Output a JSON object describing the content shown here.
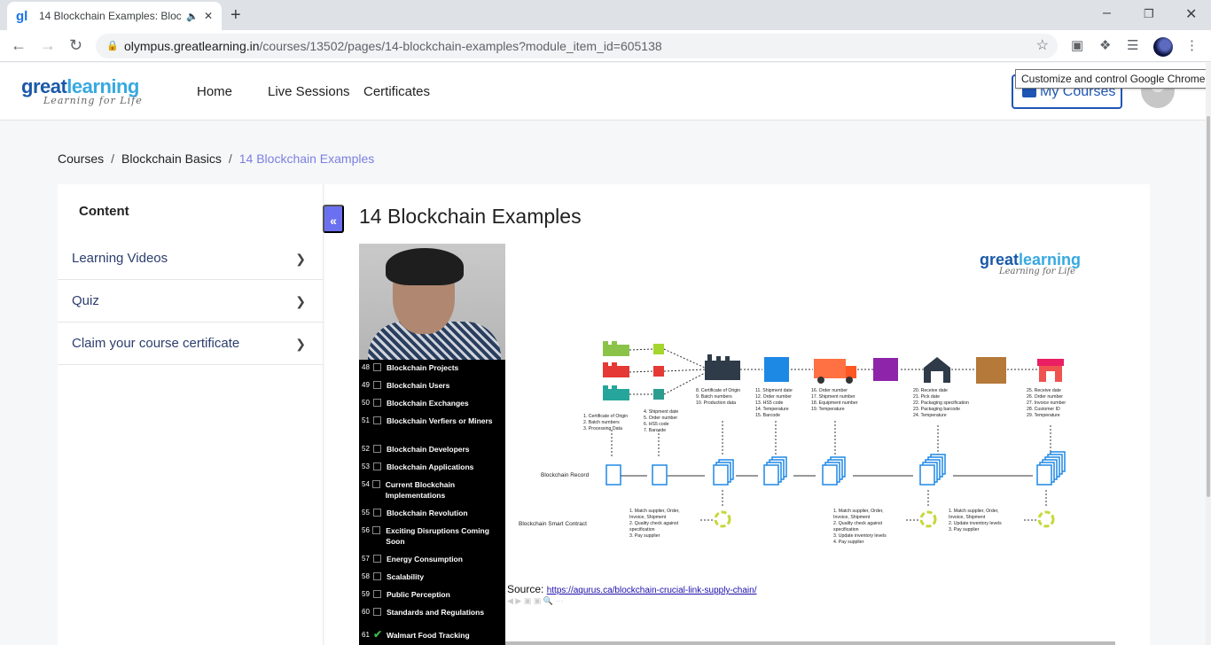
{
  "browser": {
    "tab_title": "14 Blockchain Examples: Bloc",
    "url_host": "olympus.greatlearning.in",
    "url_path": "/courses/13502/pages/14-blockchain-examples?module_item_id=605138",
    "tooltip": "Customize and control Google Chrome"
  },
  "header": {
    "logo_main": "great",
    "logo_accent": "learning",
    "logo_tagline": "Learning for Life",
    "nav": [
      "Home",
      "Live Sessions",
      "Certificates"
    ],
    "my_courses": "My Courses"
  },
  "breadcrumb": {
    "items": [
      "Courses",
      "Blockchain Basics"
    ],
    "current": "14 Blockchain Examples"
  },
  "sidebar": {
    "title": "Content",
    "sections": [
      "Learning Videos",
      "Quiz",
      "Claim your course certificate"
    ]
  },
  "page": {
    "title": "14 Blockchain Examples",
    "source_label": "Source:",
    "source_url": "https://aqurus.ca/blockchain-crucial-link-supply-chain/"
  },
  "video_list": [
    {
      "n": "48",
      "text": "Blockchain Projects"
    },
    {
      "n": "49",
      "text": "Blockchain Users"
    },
    {
      "n": "50",
      "text": "Blockchain Exchanges"
    },
    {
      "n": "51",
      "text": "Blockchain Verfiers or Miners"
    },
    {
      "n": "52",
      "text": "Blockchain Developers"
    },
    {
      "n": "53",
      "text": "Blockchain Applications"
    },
    {
      "n": "54",
      "text": "Current Blockchain Implementations"
    },
    {
      "n": "55",
      "text": "Blockchain Revolution"
    },
    {
      "n": "56",
      "text": "Exciting Disruptions Coming Soon"
    },
    {
      "n": "57",
      "text": "Energy Consumption"
    },
    {
      "n": "58",
      "text": "Scalability"
    },
    {
      "n": "59",
      "text": "Public Perception"
    },
    {
      "n": "60",
      "text": "Standards and Regulations"
    },
    {
      "n": "61",
      "text": "Walmart Food Tracking",
      "checked": true
    }
  ],
  "diagram": {
    "row_record": "Blockchain Record",
    "row_contract": "Blockchain Smart Contract",
    "blocks": [
      [
        "1. Certificate of Origin",
        "2. Batch numbers",
        "3. Processing Data"
      ],
      [
        "4. Shipment date",
        "5. Order number",
        "6. HS5 code",
        "7. Barcode"
      ],
      [
        "8. Certificate of Origin",
        "9. Batch numbers",
        "10. Production data"
      ],
      [
        "11. Shipment date",
        "12. Order number",
        "13. HS5 code",
        "14. Temperature",
        "15. Barcode"
      ],
      [
        "16. Order number",
        "17. Shipment number",
        "18. Equipment number",
        "19. Temperature"
      ],
      [
        "20. Receive date",
        "21. Pick date",
        "22. Packaging specification",
        "23. Packaging barcode",
        "24. Temperature"
      ],
      [
        "25. Receive date",
        "26. Order number",
        "27. Invoice number",
        "28. Customer ID",
        "29. Temperature"
      ]
    ],
    "contracts": [
      [
        "1. Match supplier, Order,",
        "Invoice, Shipment",
        "2. Quality check against",
        "specification",
        "3. Pay supplier"
      ],
      [
        "1. Match supplier, Order,",
        "Invoice, Shipment",
        "2. Quality check against",
        "specification",
        "3. Update inventory levels",
        "4. Pay supplier"
      ],
      [
        "1. Match supplier, Order,",
        "Invoice, Shipment",
        "2. Update inventory levels",
        "3. Pay supplier"
      ]
    ]
  }
}
